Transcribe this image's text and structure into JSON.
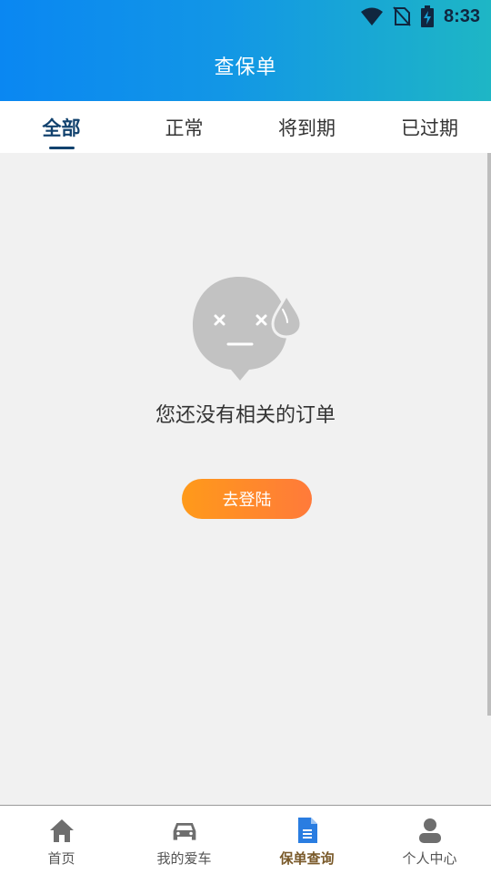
{
  "status_bar": {
    "time": "8:33"
  },
  "header": {
    "title": "查保单"
  },
  "tabs": [
    {
      "label": "全部",
      "active": true
    },
    {
      "label": "正常",
      "active": false
    },
    {
      "label": "将到期",
      "active": false
    },
    {
      "label": "已过期",
      "active": false
    }
  ],
  "empty_state": {
    "message": "您还没有相关的订单",
    "button_label": "去登陆"
  },
  "bottom_nav": [
    {
      "label": "首页",
      "icon": "home-icon",
      "active": false
    },
    {
      "label": "我的爱车",
      "icon": "car-icon",
      "active": false
    },
    {
      "label": "保单查询",
      "icon": "document-icon",
      "active": true
    },
    {
      "label": "个人中心",
      "icon": "person-icon",
      "active": false
    }
  ],
  "colors": {
    "header_gradient_start": "#0a87f2",
    "header_gradient_end": "#1eb6c5",
    "active_tab": "#12426e",
    "button_gradient_start": "#ff9a1a",
    "button_gradient_end": "#ff7a3a",
    "active_nav_icon": "#2a7de1",
    "active_nav_label": "#7a5a2a",
    "inactive_nav": "#6e6e6e"
  }
}
